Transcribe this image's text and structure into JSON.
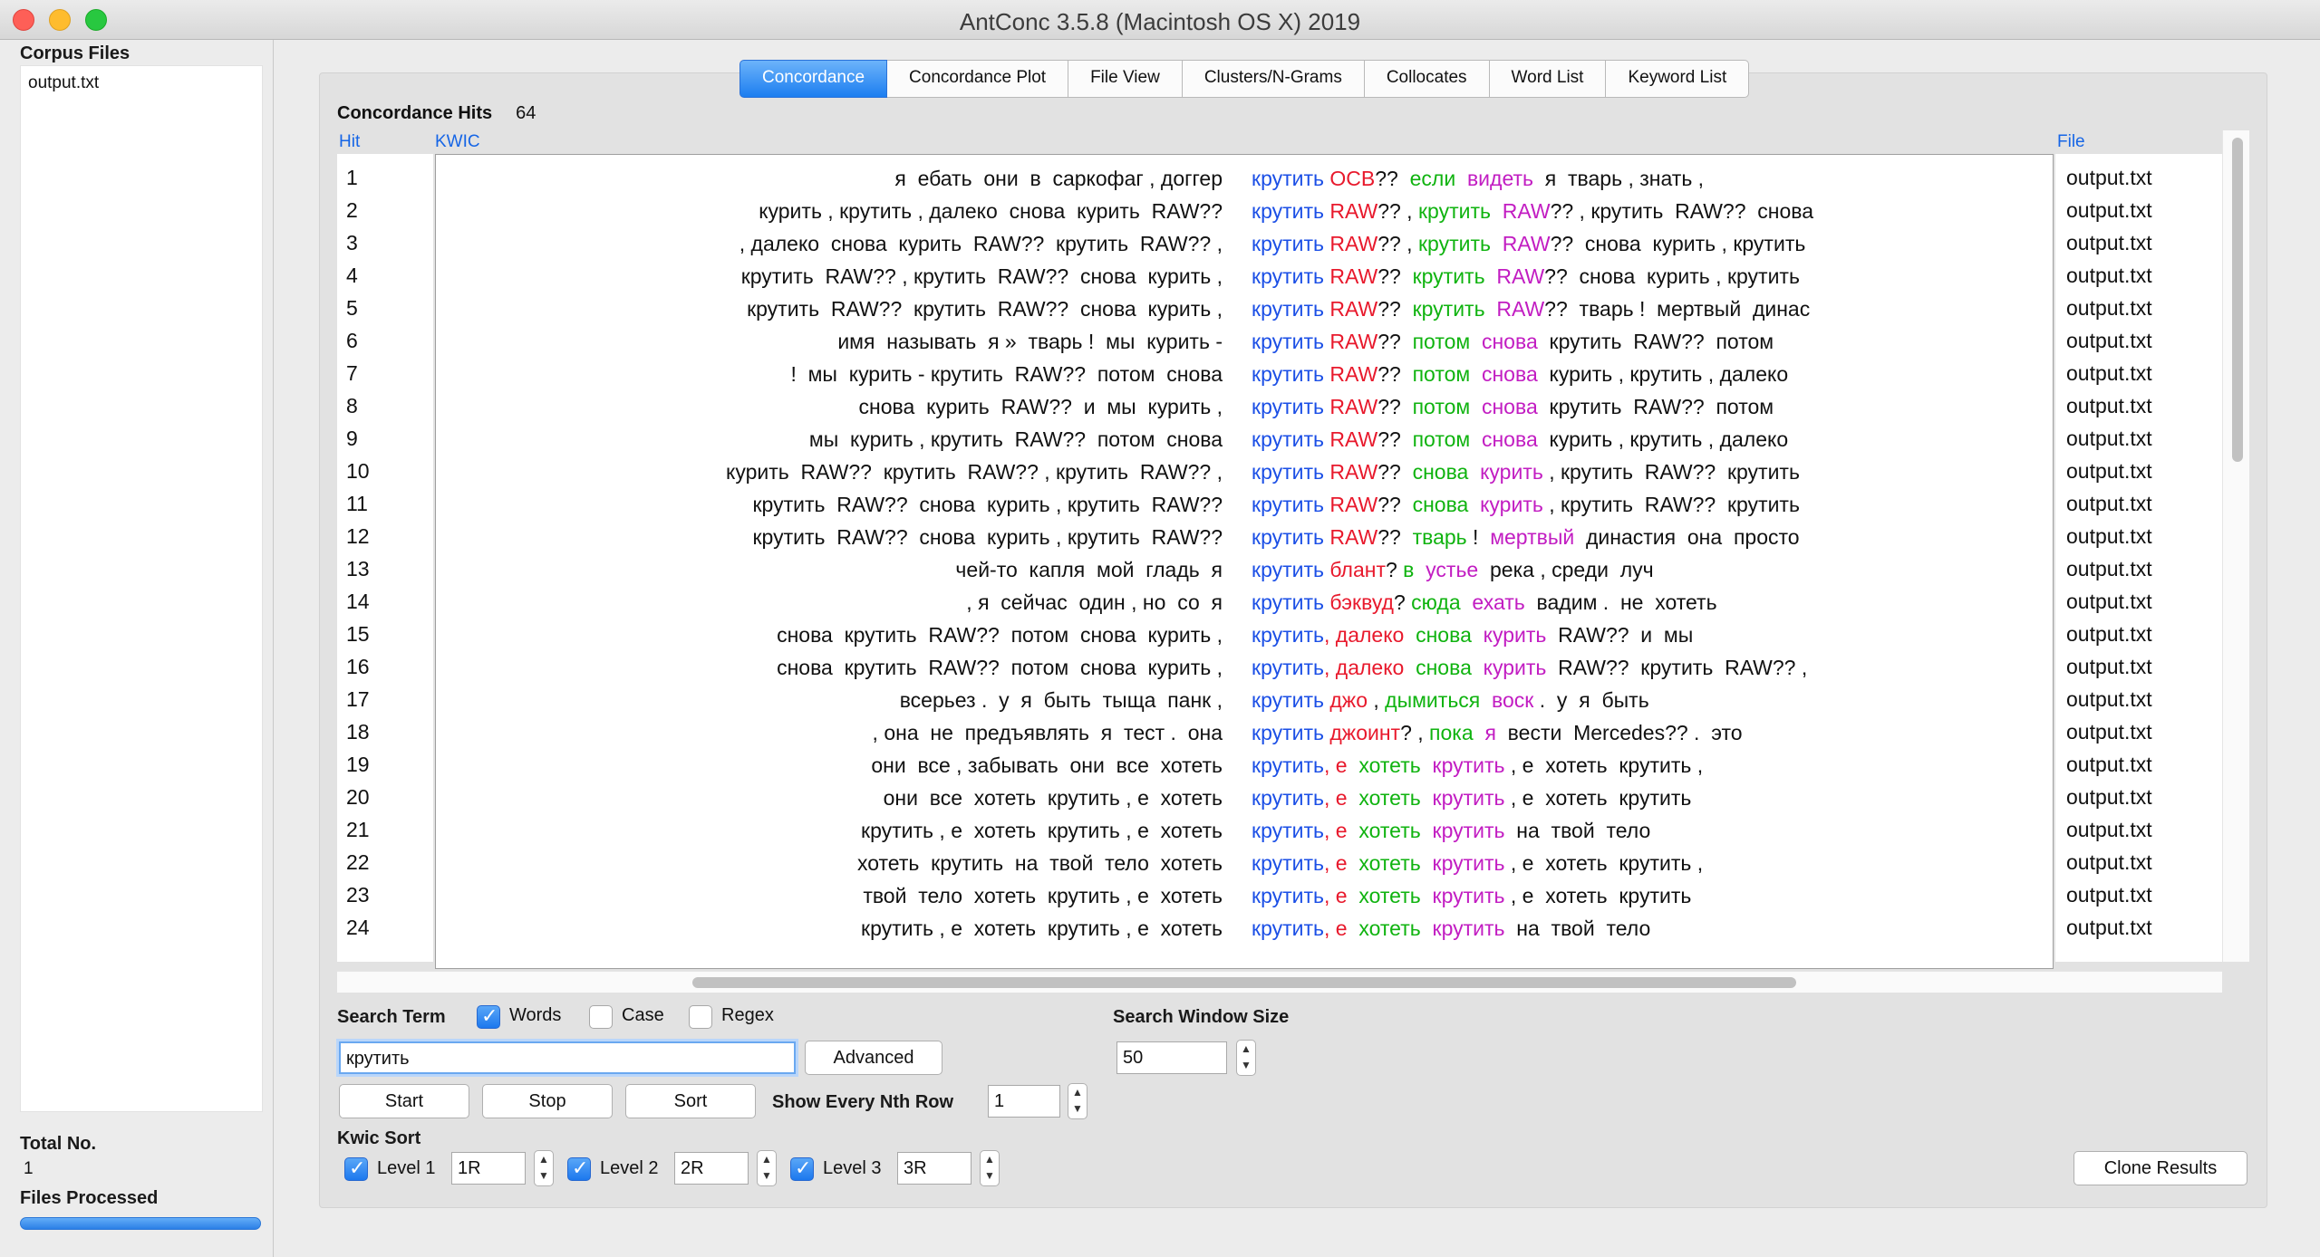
{
  "window": {
    "title": "AntConc 3.5.8 (Macintosh OS X) 2019"
  },
  "left_panel": {
    "corpus_files_label": "Corpus Files",
    "files": [
      "output.txt"
    ],
    "total_no_label": "Total No.",
    "total_no_value": "1",
    "files_processed_label": "Files Processed",
    "progress_percent": 100
  },
  "tabs": [
    {
      "label": "Concordance",
      "active": true
    },
    {
      "label": "Concordance Plot",
      "active": false
    },
    {
      "label": "File View",
      "active": false
    },
    {
      "label": "Clusters/N-Grams",
      "active": false
    },
    {
      "label": "Collocates",
      "active": false
    },
    {
      "label": "Word List",
      "active": false
    },
    {
      "label": "Keyword List",
      "active": false
    }
  ],
  "concordance": {
    "hits_label": "Concordance Hits",
    "hits_count": "64",
    "col_hit": "Hit",
    "col_kwic": "KWIC",
    "col_file": "File",
    "rows": [
      {
        "hit": "1",
        "left": "я  ебать  они  в  саркофаг , доггер",
        "kw": "крутить",
        "r1": " ОСВ",
        "t1": "??  ",
        "r2": "если",
        "t2": "  ",
        "r3": "видеть",
        "rest": "  я  тварь , знать ,",
        "file": "output.txt"
      },
      {
        "hit": "2",
        "left": "курить , крутить , далеко  снова  курить  RAW??",
        "kw": "крутить",
        "r1": " RAW",
        "t1": "?? , ",
        "r2": "крутить",
        "t2": "  ",
        "r3": "RAW",
        "rest": "?? , крутить  RAW??  снова",
        "file": "output.txt"
      },
      {
        "hit": "3",
        "left": ", далеко  снова  курить  RAW??  крутить  RAW?? ,",
        "kw": "крутить",
        "r1": " RAW",
        "t1": "?? , ",
        "r2": "крутить",
        "t2": "  ",
        "r3": "RAW",
        "rest": "??  снова  курить , крутить",
        "file": "output.txt"
      },
      {
        "hit": "4",
        "left": "крутить  RAW?? , крутить  RAW??  снова  курить ,",
        "kw": "крутить",
        "r1": " RAW",
        "t1": "??  ",
        "r2": "крутить",
        "t2": "  ",
        "r3": "RAW",
        "rest": "??  снова  курить , крутить",
        "file": "output.txt"
      },
      {
        "hit": "5",
        "left": "крутить  RAW??  крутить  RAW??  снова  курить ,",
        "kw": "крутить",
        "r1": " RAW",
        "t1": "??  ",
        "r2": "крутить",
        "t2": "  ",
        "r3": "RAW",
        "rest": "??  тварь !  мертвый  динас",
        "file": "output.txt"
      },
      {
        "hit": "6",
        "left": "имя  называть  я »  тварь !  мы  курить -",
        "kw": "крутить",
        "r1": " RAW",
        "t1": "??  ",
        "r2": "потом",
        "t2": "  ",
        "r3": "снова",
        "rest": "  крутить  RAW??  потом",
        "file": "output.txt"
      },
      {
        "hit": "7",
        "left": "!  мы  курить - крутить  RAW??  потом  снова",
        "kw": "крутить",
        "r1": " RAW",
        "t1": "??  ",
        "r2": "потом",
        "t2": "  ",
        "r3": "снова",
        "rest": "  курить , крутить , далеко",
        "file": "output.txt"
      },
      {
        "hit": "8",
        "left": "снова  курить  RAW??  и  мы  курить ,",
        "kw": "крутить",
        "r1": " RAW",
        "t1": "??  ",
        "r2": "потом",
        "t2": "  ",
        "r3": "снова",
        "rest": "  крутить  RAW??  потом",
        "file": "output.txt"
      },
      {
        "hit": "9",
        "left": "мы  курить , крутить  RAW??  потом  снова",
        "kw": "крутить",
        "r1": " RAW",
        "t1": "??  ",
        "r2": "потом",
        "t2": "  ",
        "r3": "снова",
        "rest": "  курить , крутить , далеко",
        "file": "output.txt"
      },
      {
        "hit": "10",
        "left": "курить  RAW??  крутить  RAW?? , крутить  RAW?? ,",
        "kw": "крутить",
        "r1": " RAW",
        "t1": "??  ",
        "r2": "снова",
        "t2": "  ",
        "r3": "курить",
        "rest": " , крутить  RAW??  крутить",
        "file": "output.txt"
      },
      {
        "hit": "11",
        "left": "крутить  RAW??  снова  курить , крутить  RAW??",
        "kw": "крутить",
        "r1": " RAW",
        "t1": "??  ",
        "r2": "снова",
        "t2": "  ",
        "r3": "курить",
        "rest": " , крутить  RAW??  крутить",
        "file": "output.txt"
      },
      {
        "hit": "12",
        "left": "крутить  RAW??  снова  курить , крутить  RAW??",
        "kw": "крутить",
        "r1": " RAW",
        "t1": "??  ",
        "r2": "тварь",
        "t2": " !  ",
        "r3": "мертвый",
        "rest": "  династия  она  просто",
        "file": "output.txt"
      },
      {
        "hit": "13",
        "left": "чей-то  капля  мой  гладь  я",
        "kw": "крутить",
        "r1": " блант",
        "t1": "? ",
        "r2": "в",
        "t2": "  ",
        "r3": "устье",
        "rest": "  река , среди  луч",
        "file": "output.txt"
      },
      {
        "hit": "14",
        "left": ", я  сейчас  один , но  со  я",
        "kw": "крутить",
        "r1": " бэквуд",
        "t1": "? ",
        "r2": "сюда",
        "t2": "  ",
        "r3": "ехать",
        "rest": "  вадим .  не  хотеть",
        "file": "output.txt"
      },
      {
        "hit": "15",
        "left": "снова  крутить  RAW??  потом  снова  курить ,",
        "kw": "крутить",
        "r1": ", далеко",
        "t1": "  ",
        "r2": "снова",
        "t2": "  ",
        "r3": "курить",
        "rest": "  RAW??  и  мы",
        "file": "output.txt"
      },
      {
        "hit": "16",
        "left": "снова  крутить  RAW??  потом  снова  курить ,",
        "kw": "крутить",
        "r1": ", далеко",
        "t1": "  ",
        "r2": "снова",
        "t2": "  ",
        "r3": "курить",
        "rest": "  RAW??  крутить  RAW?? ,",
        "file": "output.txt"
      },
      {
        "hit": "17",
        "left": "всерьез .  у  я  быть  тыща  панк ,",
        "kw": "крутить",
        "r1": " джо",
        "t1": " , ",
        "r2": "дымиться",
        "t2": "  ",
        "r3": "воск",
        "rest": " .  у  я  быть",
        "file": "output.txt"
      },
      {
        "hit": "18",
        "left": ", она  не  предъявлять  я  тест .  она",
        "kw": "крутить",
        "r1": " джоинт",
        "t1": "? , ",
        "r2": "пока",
        "t2": "  ",
        "r3": "я",
        "rest": "  вести  Mercedes?? .  это",
        "file": "output.txt"
      },
      {
        "hit": "19",
        "left": "они  все , забывать  они  все  хотеть",
        "kw": "крутить",
        "r1": ", е",
        "t1": "  ",
        "r2": "хотеть",
        "t2": "  ",
        "r3": "крутить",
        "rest": " , е  хотеть  крутить ,",
        "file": "output.txt"
      },
      {
        "hit": "20",
        "left": "они  все  хотеть  крутить , е  хотеть",
        "kw": "крутить",
        "r1": ", е",
        "t1": "  ",
        "r2": "хотеть",
        "t2": "  ",
        "r3": "крутить",
        "rest": " , е  хотеть  крутить",
        "file": "output.txt"
      },
      {
        "hit": "21",
        "left": "крутить , е  хотеть  крутить , е  хотеть",
        "kw": "крутить",
        "r1": ", е",
        "t1": "  ",
        "r2": "хотеть",
        "t2": "  ",
        "r3": "крутить",
        "rest": "  на  твой  тело",
        "file": "output.txt"
      },
      {
        "hit": "22",
        "left": "хотеть  крутить  на  твой  тело  хотеть",
        "kw": "крутить",
        "r1": ", е",
        "t1": "  ",
        "r2": "хотеть",
        "t2": "  ",
        "r3": "крутить",
        "rest": " , е  хотеть  крутить ,",
        "file": "output.txt"
      },
      {
        "hit": "23",
        "left": "твой  тело  хотеть  крутить , е  хотеть",
        "kw": "крутить",
        "r1": ", е",
        "t1": "  ",
        "r2": "хотеть",
        "t2": "  ",
        "r3": "крутить",
        "rest": " , е  хотеть  крутить",
        "file": "output.txt"
      },
      {
        "hit": "24",
        "left": "крутить , е  хотеть  крутить , е  хотеть",
        "kw": "крутить",
        "r1": ", е",
        "t1": "  ",
        "r2": "хотеть",
        "t2": "  ",
        "r3": "крутить",
        "rest": "  на  твой  тело",
        "file": "output.txt"
      }
    ]
  },
  "search": {
    "search_term_label": "Search Term",
    "words_label": "Words",
    "words_checked": true,
    "case_label": "Case",
    "case_checked": false,
    "regex_label": "Regex",
    "regex_checked": false,
    "term_value": "крутить",
    "advanced_label": "Advanced",
    "start_label": "Start",
    "stop_label": "Stop",
    "sort_label": "Sort",
    "show_every_label": "Show Every Nth Row",
    "show_every_value": "1",
    "window_size_label": "Search Window Size",
    "window_size_value": "50"
  },
  "kwic_sort": {
    "label": "Kwic Sort",
    "levels": [
      {
        "label": "Level 1",
        "value": "1R",
        "checked": true
      },
      {
        "label": "Level 2",
        "value": "2R",
        "checked": true
      },
      {
        "label": "Level 3",
        "value": "3R",
        "checked": true
      }
    ],
    "clone_label": "Clone Results"
  },
  "colors": {
    "keyword": "#1b4fe6",
    "sort_level_1": "#e8192c",
    "sort_level_2": "#0fb30f",
    "sort_level_3": "#c21dc2",
    "accent": "#1c7ef0"
  }
}
